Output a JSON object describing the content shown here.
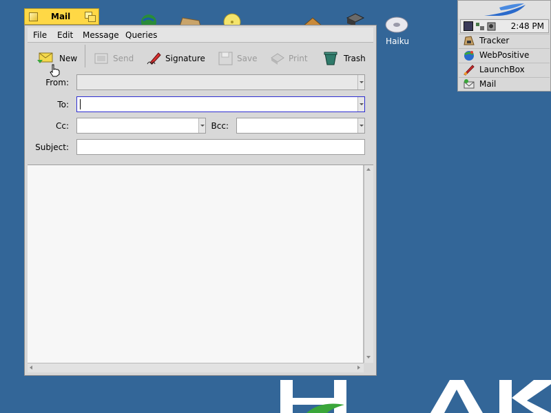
{
  "desktop": {
    "haiku_label": "Haiku",
    "watermark_text": "HAIKU"
  },
  "deskbar": {
    "clock": "2:48 PM",
    "items": [
      {
        "label": "Tracker",
        "icon": "tracker-icon"
      },
      {
        "label": "WebPositive",
        "icon": "webpositive-icon"
      },
      {
        "label": "LaunchBox",
        "icon": "launchbox-icon"
      },
      {
        "label": "Mail",
        "icon": "mail-icon"
      }
    ]
  },
  "window": {
    "title": "Mail",
    "menu": [
      "File",
      "Edit",
      "Message",
      "Queries"
    ],
    "toolbar": {
      "new_label": "New",
      "send_label": "Send",
      "signature_label": "Signature",
      "save_label": "Save",
      "print_label": "Print",
      "trash_label": "Trash"
    },
    "fields": {
      "from_label": "From:",
      "from_value": "",
      "to_label": "To:",
      "to_value": "",
      "cc_label": "Cc:",
      "cc_value": "",
      "bcc_label": "Bcc:",
      "bcc_value": "",
      "subject_label": "Subject:",
      "subject_value": ""
    },
    "body_text": ""
  }
}
